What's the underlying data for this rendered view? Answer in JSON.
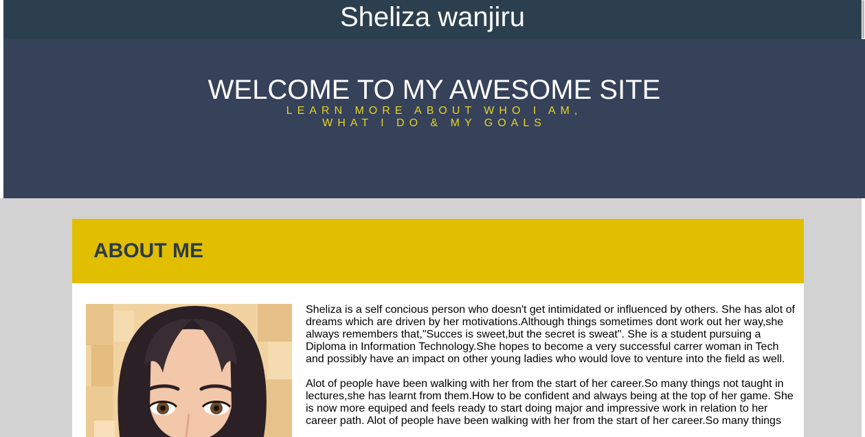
{
  "site": {
    "owner_name": "Sheliza wanjiru"
  },
  "hero": {
    "title": "WELCOME TO MY AWESOME SITE",
    "subtitle_line1": "LEARN MORE ABOUT WHO I AM,",
    "subtitle_line2": "WHAT I DO & MY GOALS"
  },
  "about": {
    "heading": "ABOUT ME",
    "paragraphs": [
      "Sheliza is a self concious person who doesn't get intimidated or influenced by others. She has alot of dreams which are driven by her motivations.Although things sometimes dont work out her way,she always remembers that,\"Succes is sweet,but the secret is sweat\". She is a student pursuing a Diploma in Information Technology.She hopes to become a very successful carrer woman in Tech and possibly have an impact on other young ladies who would love to venture into the field as well.",
      "Alot of people have been walking with her from the start of her career.So many things not taught in lectures,she has learnt from them.How to be confident and always being at the top of her game. She is now more equiped and feels ready to start doing major and impressive work in relation to her career path. Alot of people have been walking with her from the start of her career.So many things"
    ],
    "avatar_icon": "cartoon-woman-avatar"
  },
  "colors": {
    "top_bar": "#2c3f4f",
    "hero_bg": "#36415a",
    "accent_yellow": "#e1be00",
    "subtitle_yellow": "#e6d521",
    "page_bg": "#d3d2d3"
  }
}
